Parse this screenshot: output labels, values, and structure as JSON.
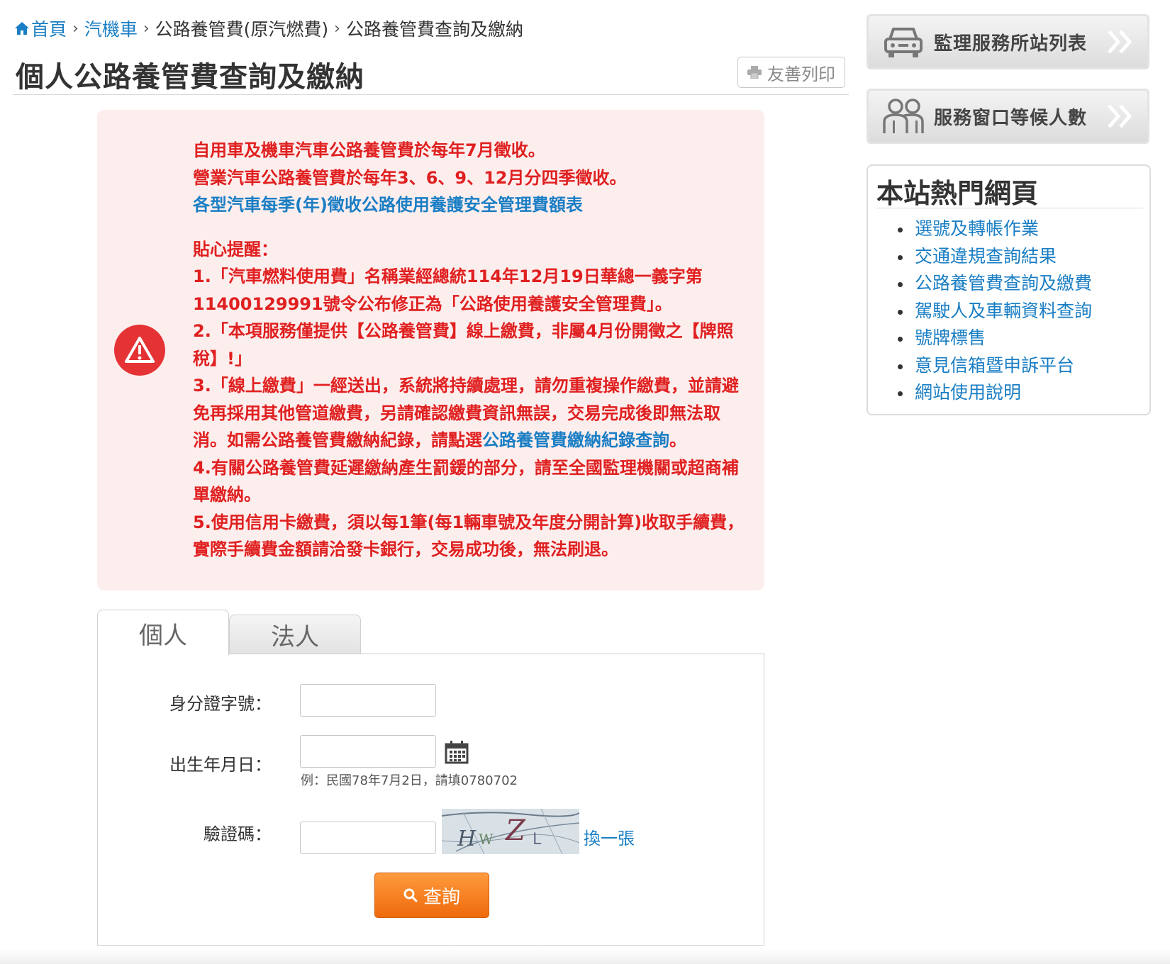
{
  "breadcrumb": {
    "home": "首頁",
    "item1": "汽機車",
    "item2": "公路養管費(原汽燃費)",
    "item3": "公路養管費查詢及繳納",
    "separator": "›"
  },
  "page": {
    "title": "個人公路養管費查詢及繳納",
    "print_label": "友善列印"
  },
  "notice": {
    "line1": "自用車及機車汽車公路養管費於每年7月徵收。",
    "line2": "營業汽車公路養管費於每年3、6、9、12月分四季徵收。",
    "fee_table_link": "各型汽車每季(年)徵收公路使用養護安全管理費額表",
    "reminder_title": "貼心提醒：",
    "item1": "1.「汽車燃料使用費」名稱業經總統114年12月19日華總一義字第11400129991號令公布修正為「公路使用養護安全管理費」。",
    "item2": "2.「本項服務僅提供【公路養管費】線上繳費，非屬4月份開徵之【牌照稅】!」",
    "item3_pre": "3.「線上繳費」一經送出，系統將持續處理，請勿重複操作繳費，並請避免再採用其他管道繳費，另請確認繳費資訊無誤，交易完成後即無法取消。如需公路養管費繳納紀錄，請點選",
    "item3_link": "公路養管費繳納紀錄查詢",
    "item3_post": "。",
    "item4": "4.有關公路養管費延遲繳納產生罰鍰的部分，請至全國監理機關或超商補單繳納。",
    "item5": "5.使用信用卡繳費，須以每1筆(每1輛車號及年度分開計算)收取手續費，實際手續費金額請洽發卡銀行，交易成功後，無法刷退。"
  },
  "tabs": {
    "personal": "個人",
    "corporate": "法人"
  },
  "form": {
    "id_label": "身分證字號：",
    "id_value": "",
    "birth_label": "出生年月日：",
    "birth_value": "",
    "birth_hint": "例：民國78年7月2日，請填0780702",
    "captcha_label": "驗證碼：",
    "captcha_value": "",
    "captcha_text": "HWZL",
    "refresh_label": "換一張",
    "submit_label": "查詢"
  },
  "sidebar": {
    "stations_label": "監理服務所站列表",
    "queue_label": "服務窗口等候人數",
    "hot_title": "本站熱門網頁",
    "hot_links": [
      "選號及轉帳作業",
      "交通違規查詢結果",
      "公路養管費查詢及繳費",
      "駕駛人及車輛資料查詢",
      "號牌標售",
      "意見信箱暨申訴平台",
      "網站使用說明"
    ]
  },
  "colors": {
    "link": "#1a7ec4",
    "notice_text": "#e02020",
    "notice_bg": "#fdeeee",
    "button": "#f07a1a"
  }
}
